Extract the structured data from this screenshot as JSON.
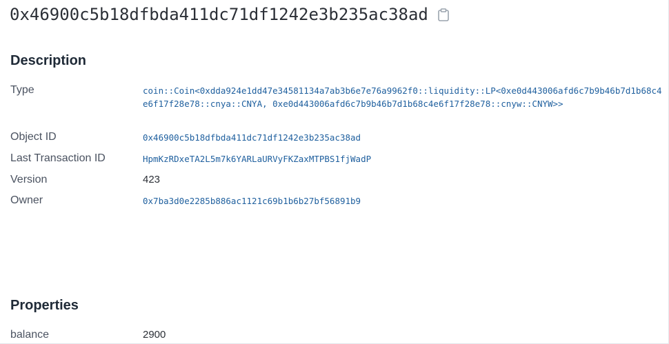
{
  "header": {
    "object_id": "0x46900c5b18dfbda411dc71df1242e3b235ac38ad"
  },
  "description": {
    "title": "Description",
    "rows": {
      "type": {
        "label": "Type",
        "value": "coin::Coin<0xdda924e1dd47e34581134a7ab3b6e7e76a9962f0::liquidity::LP<0xe0d443006afd6c7b9b46b7d1b68c4e6f17f28e78::cnya::CNYA, 0xe0d443006afd6c7b9b46b7d1b68c4e6f17f28e78::cnyw::CNYW>>"
      },
      "object_id": {
        "label": "Object ID",
        "value": "0x46900c5b18dfbda411dc71df1242e3b235ac38ad"
      },
      "last_tx": {
        "label": "Last Transaction ID",
        "value": "HpmKzRDxeTA2L5m7k6YARLaURVyFKZaxMTPBS1fjWadP"
      },
      "version": {
        "label": "Version",
        "value": "423"
      },
      "owner": {
        "label": "Owner",
        "value": "0x7ba3d0e2285b886ac1121c69b1b6b27bf56891b9"
      }
    }
  },
  "properties": {
    "title": "Properties",
    "balance": {
      "label": "balance",
      "value": "2900"
    }
  },
  "icons": {
    "copy": "clipboard-icon"
  },
  "colors": {
    "link": "#1e5f9e",
    "text": "#1f2a37",
    "label": "#4a5260"
  }
}
